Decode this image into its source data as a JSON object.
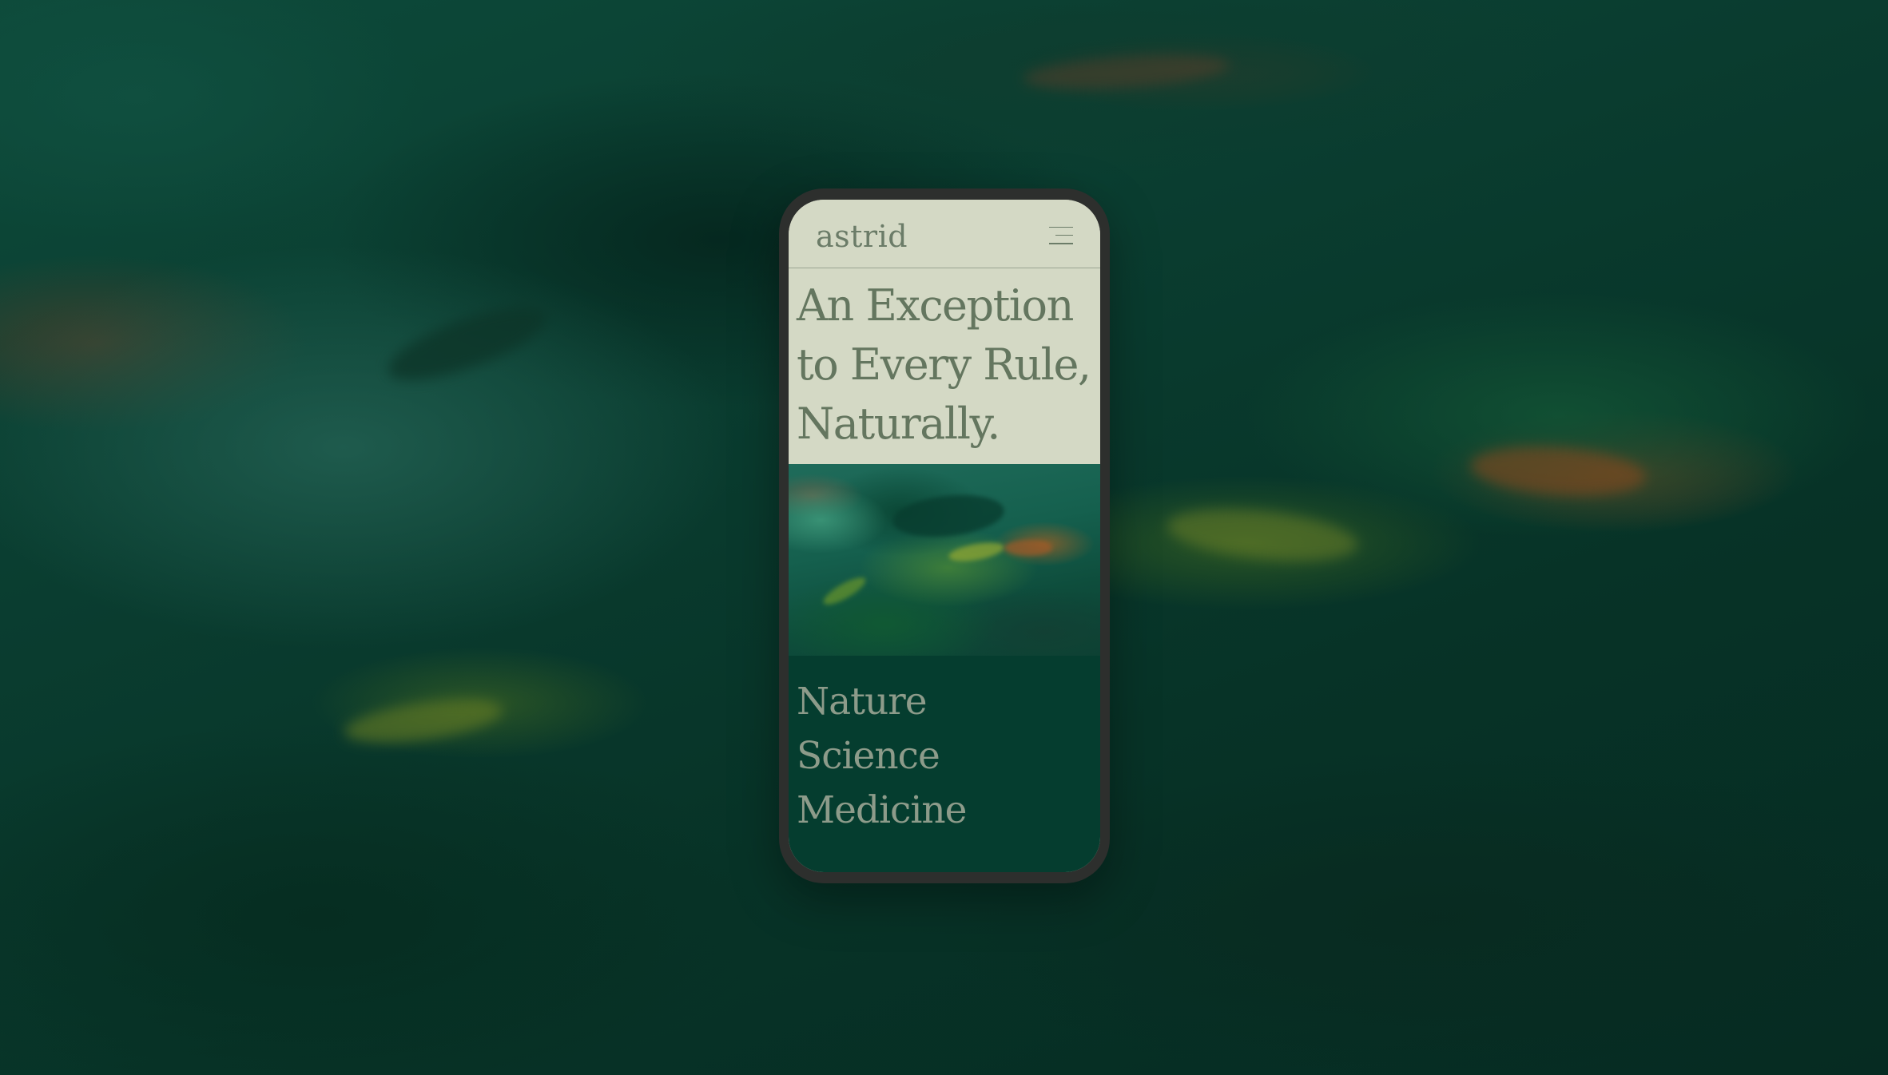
{
  "brand": {
    "logo": "astrid"
  },
  "header": {
    "menu_icon": "hamburger-menu-icon"
  },
  "hero": {
    "headline_lines": [
      "An Exception",
      "to Every Rule,",
      "Naturally."
    ]
  },
  "nav": {
    "items": [
      "Nature",
      "Science",
      "Medicine"
    ]
  },
  "colors": {
    "frame": "#2d2f2d",
    "header_bg": "#d4d9c5",
    "headline_text": "#64765f",
    "nav_bg": "#053d2f",
    "nav_text": "#8d9b8a",
    "background": "#0a3a2c"
  }
}
